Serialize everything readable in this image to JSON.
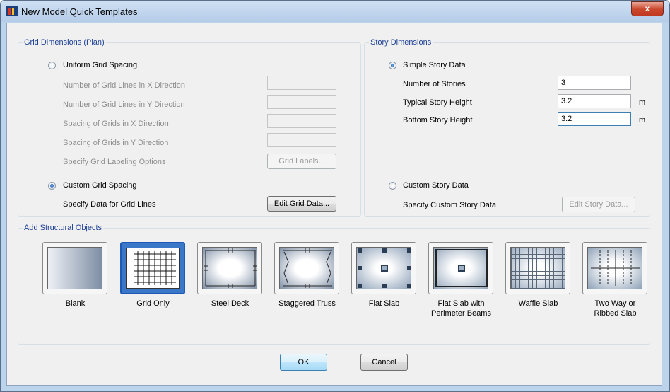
{
  "window": {
    "title": "New Model Quick Templates",
    "close_glyph": "x"
  },
  "grid_dimensions": {
    "legend": "Grid Dimensions (Plan)",
    "uniform": {
      "label": "Uniform Grid Spacing",
      "rows": [
        "Number of Grid Lines in X Direction",
        "Number of Grid Lines in Y Direction",
        "Spacing of Grids in X Direction",
        "Spacing of Grids in Y Direction",
        "Specify Grid Labeling Options"
      ],
      "grid_labels_button": "Grid Labels..."
    },
    "custom": {
      "label": "Custom Grid Spacing",
      "row_label": "Specify Data for Grid Lines",
      "edit_button": "Edit Grid Data..."
    },
    "selected": "custom"
  },
  "story_dimensions": {
    "legend": "Story Dimensions",
    "simple": {
      "label": "Simple Story Data",
      "number_of_stories_label": "Number of Stories",
      "number_of_stories": "3",
      "typical_height_label": "Typical Story Height",
      "typical_height": "3.2",
      "typical_unit": "m",
      "bottom_height_label": "Bottom Story Height",
      "bottom_height": "3.2",
      "bottom_unit": "m"
    },
    "custom": {
      "label": "Custom Story Data",
      "row_label": "Specify Custom Story Data",
      "edit_button": "Edit Story Data..."
    },
    "selected": "simple"
  },
  "structural_objects": {
    "legend": "Add Structural Objects",
    "tiles": [
      {
        "label": "Blank",
        "icon": "blank-template-icon"
      },
      {
        "label": "Grid Only",
        "icon": "grid-only-icon",
        "selected": true
      },
      {
        "label": "Steel Deck",
        "icon": "steel-deck-icon"
      },
      {
        "label": "Staggered Truss",
        "icon": "staggered-truss-icon"
      },
      {
        "label": "Flat Slab",
        "icon": "flat-slab-icon"
      },
      {
        "label": "Flat Slab with Perimeter Beams",
        "line1": "Flat Slab with",
        "line2": "Perimeter Beams",
        "icon": "flat-slab-perimeter-beams-icon"
      },
      {
        "label": "Waffle Slab",
        "icon": "waffle-slab-icon"
      },
      {
        "label": "Two Way or Ribbed Slab",
        "line1": "Two Way or",
        "line2": "Ribbed Slab",
        "icon": "two-way-ribbed-slab-icon"
      }
    ]
  },
  "buttons": {
    "ok": "OK",
    "cancel": "Cancel"
  },
  "colors": {
    "legend_text": "#1c3f95",
    "selection": "#1e5ab5",
    "title_bar": "#bcd3ec"
  }
}
